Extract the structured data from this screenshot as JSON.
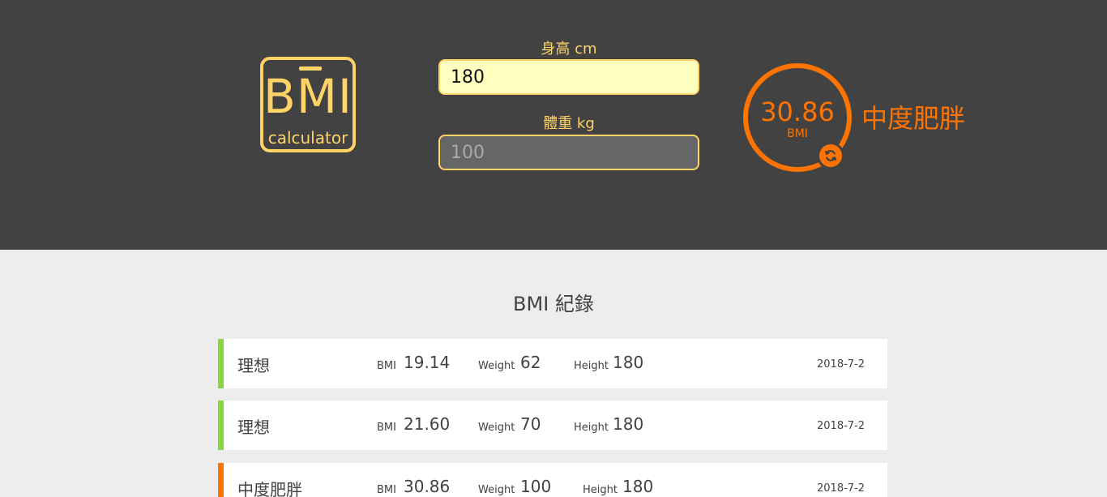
{
  "logo": {
    "title": "BMI",
    "subtitle": "calculator"
  },
  "form": {
    "height_label": "身高 cm",
    "height_value": "180",
    "weight_label": "體重 kg",
    "weight_placeholder": "100"
  },
  "result": {
    "bmi": "30.86",
    "unit": "BMI",
    "status": "中度肥胖",
    "color": "#ff7300"
  },
  "records": {
    "title": "BMI 紀錄",
    "bmi_key": "BMI",
    "weight_key": "Weight",
    "height_key": "Height",
    "items": [
      {
        "status": "理想",
        "bmi": "19.14",
        "weight": "62",
        "height": "180",
        "date": "2018-7-2",
        "color": "#86d73e"
      },
      {
        "status": "理想",
        "bmi": "21.60",
        "weight": "70",
        "height": "180",
        "date": "2018-7-2",
        "color": "#86d73e"
      },
      {
        "status": "中度肥胖",
        "bmi": "30.86",
        "weight": "100",
        "height": "180",
        "date": "2018-7-2",
        "color": "#ff7300"
      }
    ]
  },
  "colors": {
    "header_bg": "#424242",
    "accent": "#ffd366",
    "page_bg": "#ededed"
  }
}
